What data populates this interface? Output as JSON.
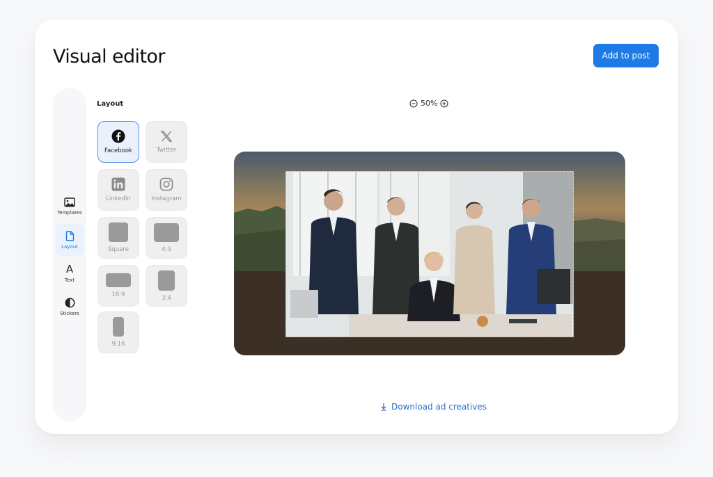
{
  "header": {
    "title": "Visual editor",
    "add_button": "Add to post"
  },
  "sidebar": {
    "items": [
      {
        "label": "Templates",
        "icon": "image-icon",
        "active": false
      },
      {
        "label": "Layout",
        "icon": "file-icon",
        "active": true
      },
      {
        "label": "Text",
        "icon": "text-icon",
        "glyph": "A",
        "active": false
      },
      {
        "label": "Stickers",
        "icon": "half-circle-icon",
        "active": false
      }
    ]
  },
  "layout_panel": {
    "heading": "Layout",
    "options": [
      {
        "label": "Facebook",
        "icon": "facebook-icon",
        "selected": true
      },
      {
        "label": "Twitter",
        "icon": "x-icon",
        "selected": false
      },
      {
        "label": "LinkedIn",
        "icon": "linkedin-icon",
        "selected": false
      },
      {
        "label": "Instagram",
        "icon": "instagram-icon",
        "selected": false
      },
      {
        "label": "Square",
        "icon": "square-shape-icon",
        "selected": false
      },
      {
        "label": "4:3",
        "icon": "ratio-4-3-icon",
        "selected": false
      },
      {
        "label": "16:9",
        "icon": "ratio-16-9-icon",
        "selected": false
      },
      {
        "label": "3:4",
        "icon": "ratio-3-4-icon",
        "selected": false
      },
      {
        "label": "9:16",
        "icon": "ratio-9-16-icon",
        "selected": false
      }
    ]
  },
  "zoom": {
    "level": "50%"
  },
  "canvas": {
    "image": "group-office-photo"
  },
  "footer": {
    "download_label": "Download ad creatives"
  },
  "colors": {
    "accent": "#1d7ae6",
    "selected_tile_bg": "#eaf1fc",
    "link": "#2c6fce"
  }
}
